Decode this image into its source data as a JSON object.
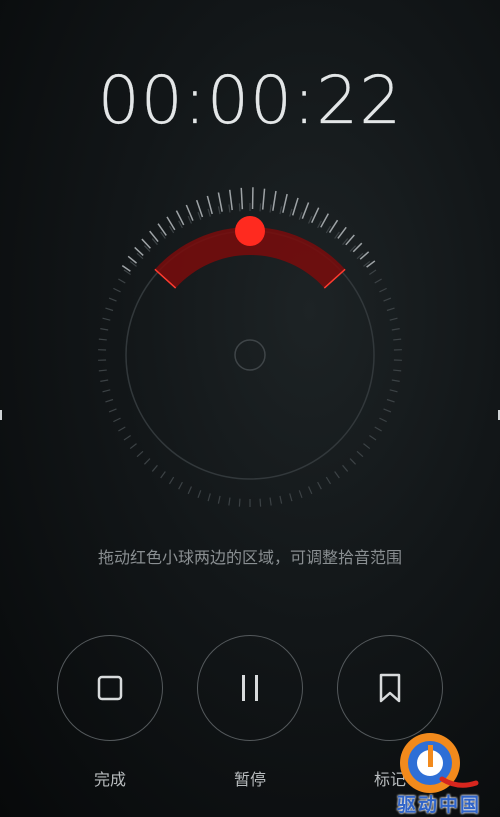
{
  "recorder": {
    "elapsed_time": "00:00:22",
    "hint": "拖动红色小球两边的区域，可调整拾音范围"
  },
  "colors": {
    "accent_red": "#ff2a1f",
    "pickup_zone": "#7a0c0c",
    "tick": "#8c9194",
    "ring": "#3a3f42"
  },
  "controls": {
    "finish_label": "完成",
    "pause_label": "暂停",
    "mark_label": "标记"
  },
  "watermark": {
    "text": "驱动中国"
  }
}
